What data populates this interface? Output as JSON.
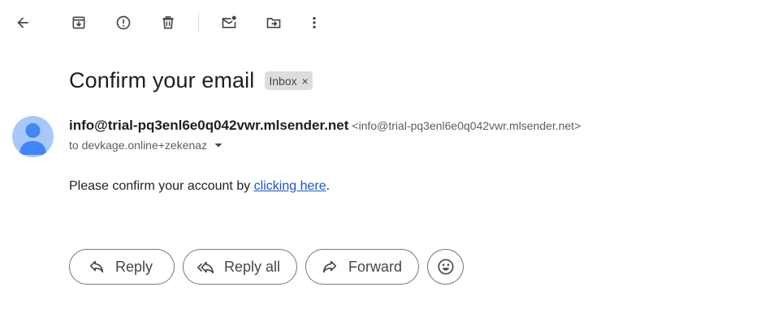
{
  "toolbar": {
    "buttons": [
      {
        "name": "back",
        "icon": "arrow-back-icon"
      },
      {
        "name": "archive",
        "icon": "archive-icon"
      },
      {
        "name": "report-spam",
        "icon": "report-icon"
      },
      {
        "name": "delete",
        "icon": "trash-icon"
      },
      {
        "name": "mark-unread",
        "icon": "mark-unread-icon"
      },
      {
        "name": "move-to",
        "icon": "move-to-folder-icon"
      },
      {
        "name": "more",
        "icon": "more-vert-icon"
      }
    ]
  },
  "message": {
    "subject": "Confirm your email",
    "label": "Inbox",
    "label_remove": "×",
    "sender_name": "info@trial-pq3enl6e0q042vwr.mlsender.net",
    "sender_email": "<info@trial-pq3enl6e0q042vwr.mlsender.net>",
    "recipient": "to devkage.online+zekenaz",
    "body_prefix": "Please confirm your account by ",
    "body_link": "clicking here",
    "body_suffix": "."
  },
  "actions": {
    "reply": "Reply",
    "reply_all": "Reply all",
    "forward": "Forward"
  },
  "colors": {
    "avatar_bg": "#a8c7fa",
    "avatar_fg": "#4285f4",
    "link": "#1a55c9",
    "chip_bg": "#dddddd"
  }
}
